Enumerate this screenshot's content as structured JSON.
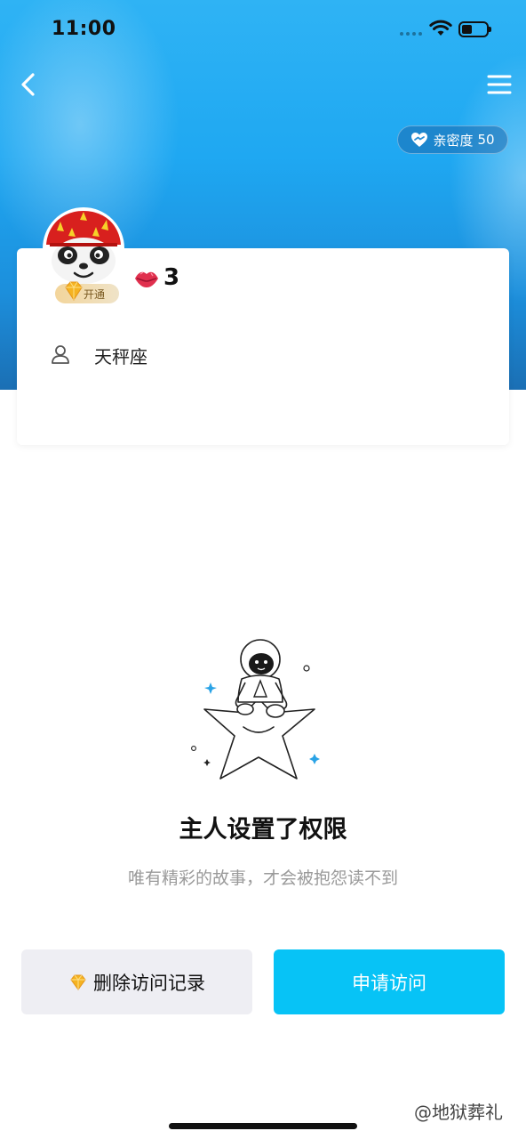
{
  "status_bar": {
    "time": "11:00"
  },
  "header": {
    "intimacy_label": "亲密度",
    "intimacy_value": "50"
  },
  "profile": {
    "vip_label": "开通",
    "lips_count": "3",
    "zodiac": "天秤座"
  },
  "permission": {
    "title": "主人设置了权限",
    "subtitle": "唯有精彩的故事，才会被抱怨读不到"
  },
  "actions": {
    "delete_label": "删除访问记录",
    "apply_label": "申请访问"
  },
  "watermark": "@地狱葬礼",
  "colors": {
    "accent": "#07c3f6",
    "banner": "#1fa8f2",
    "vip_gold": "#f3d59b",
    "lips": "#e0304e"
  },
  "icons": [
    "back-icon",
    "menu-icon",
    "heart-icon",
    "wifi-icon",
    "battery-icon",
    "diamond-icon",
    "lips-icon",
    "person-icon"
  ]
}
